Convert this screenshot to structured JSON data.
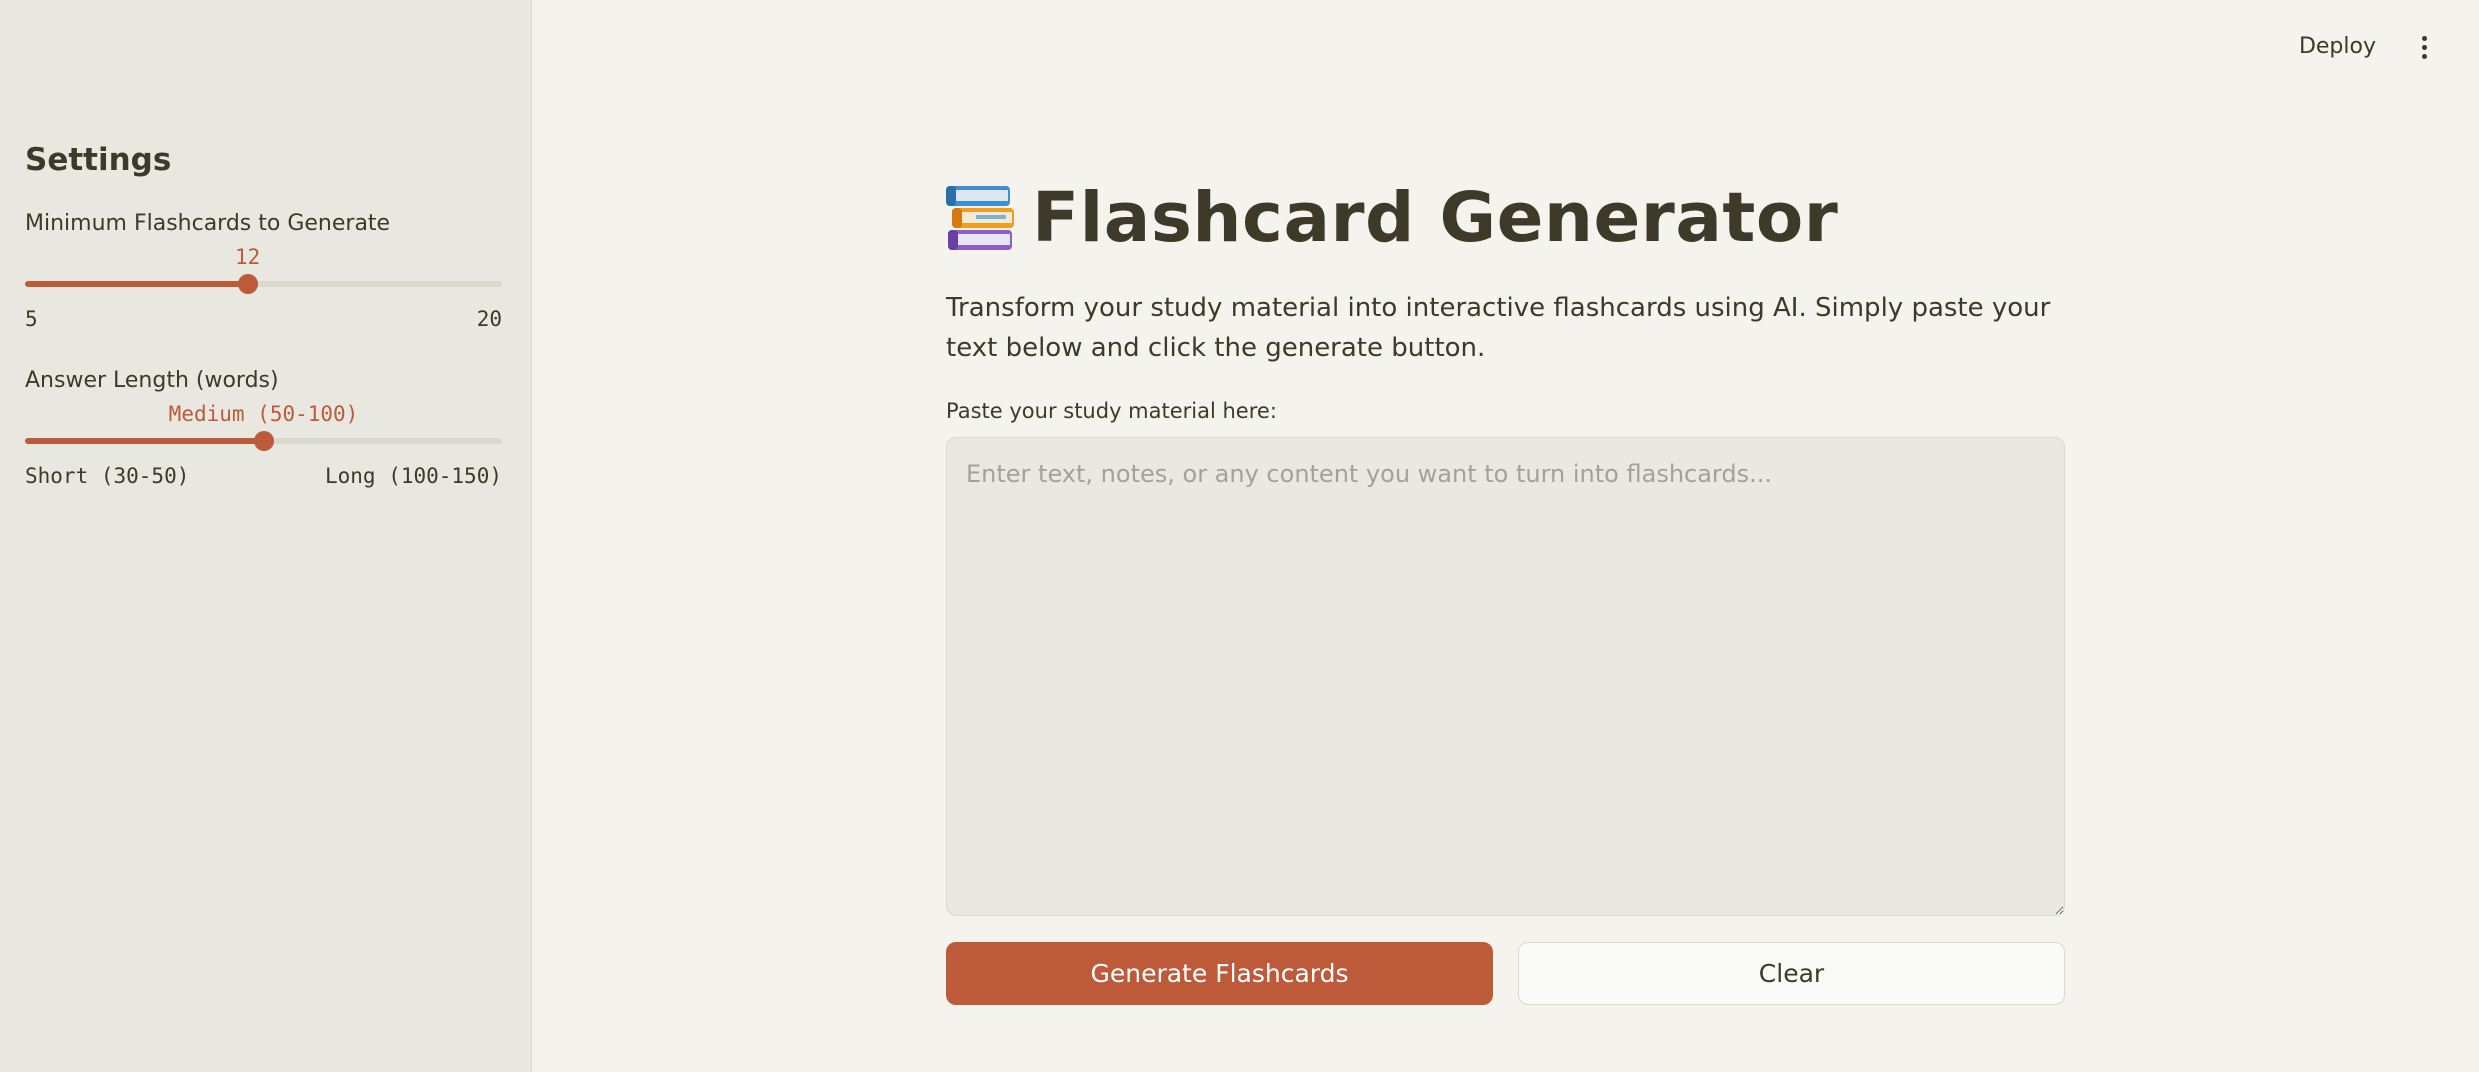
{
  "topbar": {
    "deploy_label": "Deploy",
    "menu_icon": "more-vert-icon"
  },
  "sidebar": {
    "title": "Settings",
    "sliders": [
      {
        "label": "Minimum Flashcards to Generate",
        "value_label": "12",
        "value": 12,
        "min_label": "5",
        "max_label": "20",
        "min": 5,
        "max": 20
      },
      {
        "label": "Answer Length (words)",
        "value_label": "Medium (50-100)",
        "options": [
          "Short (30-50)",
          "Medium (50-100)",
          "Long (100-150)"
        ],
        "selected_index": 1,
        "min_label": "Short (30-50)",
        "max_label": "Long (100-150)"
      }
    ]
  },
  "main": {
    "title_icon": "books-icon",
    "title": "Flashcard Generator",
    "description": "Transform your study material into interactive flashcards using AI. Simply paste your text below and click the generate button.",
    "input_label": "Paste your study material here:",
    "input_value": "",
    "input_placeholder": "Enter text, notes, or any content you want to turn into flashcards...",
    "generate_label": "Generate Flashcards",
    "clear_label": "Clear"
  },
  "colors": {
    "accent": "#bc5a3a",
    "background": "#f4f3ee",
    "sidebar_background": "#e9e8e0",
    "text": "#3d3a2a"
  }
}
